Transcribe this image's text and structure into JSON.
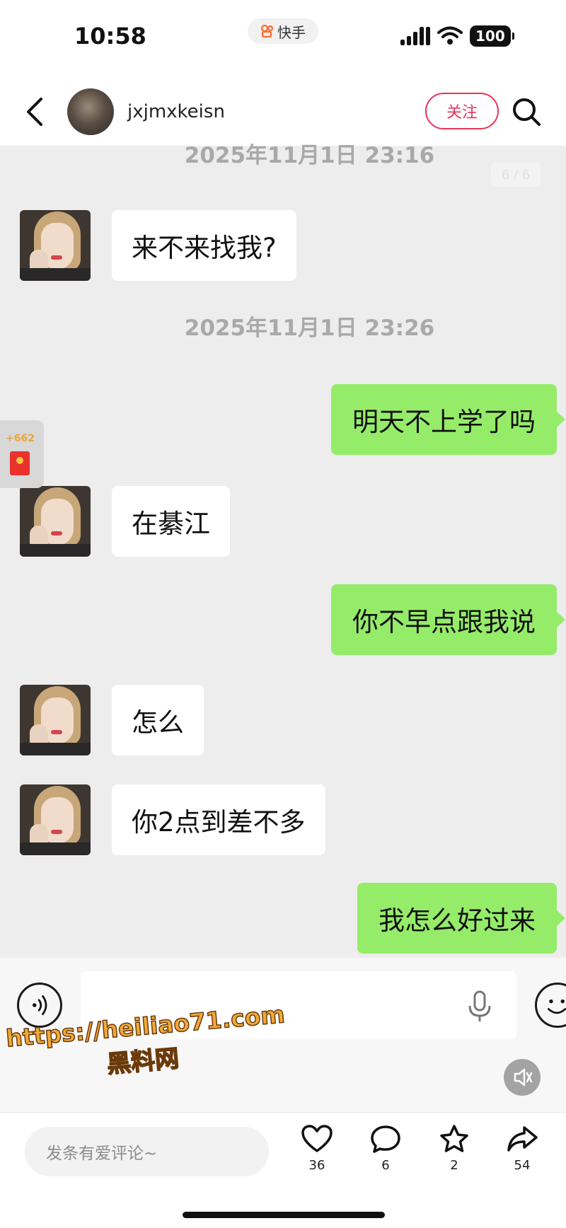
{
  "status_bar": {
    "time": "10:58",
    "app_name": "快手",
    "battery": "100"
  },
  "header": {
    "username": "jxjmxkeisn",
    "follow_label": "关注"
  },
  "chat": {
    "counter": "6 / 6",
    "timestamps": [
      "2025年11月1日 23:16",
      "2025年11月1日 23:26"
    ],
    "messages": [
      {
        "from": "them",
        "text": "来不来找我?"
      },
      {
        "from": "me",
        "text": "明天不上学了吗"
      },
      {
        "from": "them",
        "text": "在綦江"
      },
      {
        "from": "me",
        "text": "你不早点跟我说"
      },
      {
        "from": "them",
        "text": "怎么"
      },
      {
        "from": "them",
        "text": "你2点到差不多"
      },
      {
        "from": "me",
        "text": "我怎么好过来"
      }
    ],
    "redpacket_count": "+662"
  },
  "watermark": {
    "line1": "https://heiliao71.com",
    "line2": "黑料网"
  },
  "bottom_bar": {
    "comment_placeholder": "发条有爱评论~",
    "likes": "36",
    "comments": "6",
    "favorites": "2",
    "shares": "54"
  },
  "icons": {
    "back": "chevron-left-icon",
    "search": "search-icon",
    "voice": "voice-icon",
    "mic": "mic-icon",
    "emoji": "emoji-icon",
    "speaker": "speaker-icon",
    "like": "heart-icon",
    "comment": "comment-icon",
    "favorite": "star-icon",
    "share": "share-icon"
  },
  "colors": {
    "accent": "#e8335a",
    "outgoing_bubble": "#95ec69",
    "incoming_bubble": "#ffffff",
    "chat_background": "#ededed"
  }
}
